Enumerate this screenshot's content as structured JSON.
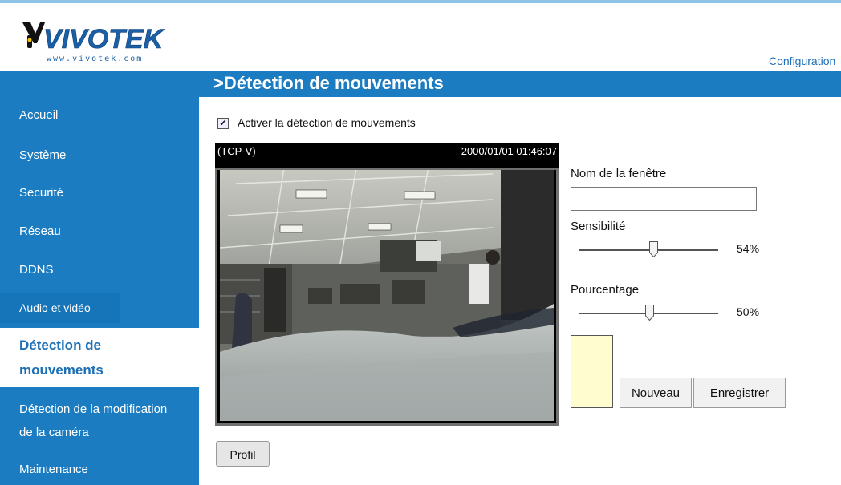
{
  "brand": {
    "name": "VIVOTEK",
    "url": "www.vivotek.com",
    "colors": {
      "blue": "#1c7cc2",
      "logo_text": "#1b5fa6",
      "logo_mark": "#111111"
    }
  },
  "header": {
    "config_link": "Configuration",
    "page_title": ">Détection de mouvements"
  },
  "sidebar": {
    "items": [
      {
        "label": "Accueil"
      },
      {
        "label": "Système"
      },
      {
        "label": "Securité"
      },
      {
        "label": "Réseau"
      },
      {
        "label": "DDNS"
      },
      {
        "label": "Audio et vidéo"
      },
      {
        "label_line1": "Détection de",
        "label_line2": "mouvements",
        "active": true
      },
      {
        "label_line1": "Détection de la modification",
        "label_line2": "de la caméra"
      },
      {
        "label": "Maintenance"
      }
    ]
  },
  "motion": {
    "enable_label": "Activer la détection de mouvements",
    "enabled": true,
    "video": {
      "camera_name": "(TCP-V)",
      "timestamp": "2000/01/01 01:46:07"
    },
    "window_name_label": "Nom de la fenêtre",
    "window_name_value": "",
    "sensitivity_label": "Sensibilité",
    "sensitivity_value": "54%",
    "sensitivity_fraction": 0.54,
    "percentage_label": "Pourcentage",
    "percentage_value": "50%",
    "percentage_fraction": 0.5,
    "window_color": "#fffccf",
    "new_button": "Nouveau",
    "save_button": "Enregistrer",
    "profile_button": "Profil"
  }
}
